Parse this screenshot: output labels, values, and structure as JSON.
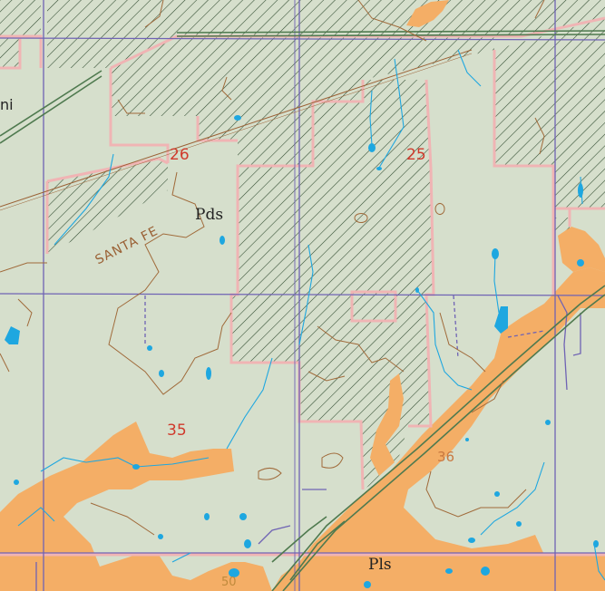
{
  "map": {
    "colors": {
      "background": "#d6dfcc",
      "alluvium": "#f4ae66",
      "hatch": "#2f4a2f",
      "land_boundary": "#f0b4b4",
      "section_line": "#6f63b4",
      "contour": "#a06a3a",
      "water": "#1ea7e0",
      "highway": "#4f7a4f",
      "section_number": "#d03a2c"
    },
    "labels": {
      "section_26": "26",
      "section_25": "25",
      "section_35": "35",
      "section_36": "36",
      "unit_pds": "Pds",
      "unit_pls": "Pls",
      "railroad": "SANTA FE",
      "edge_text": "ni",
      "elevation": "50"
    }
  }
}
